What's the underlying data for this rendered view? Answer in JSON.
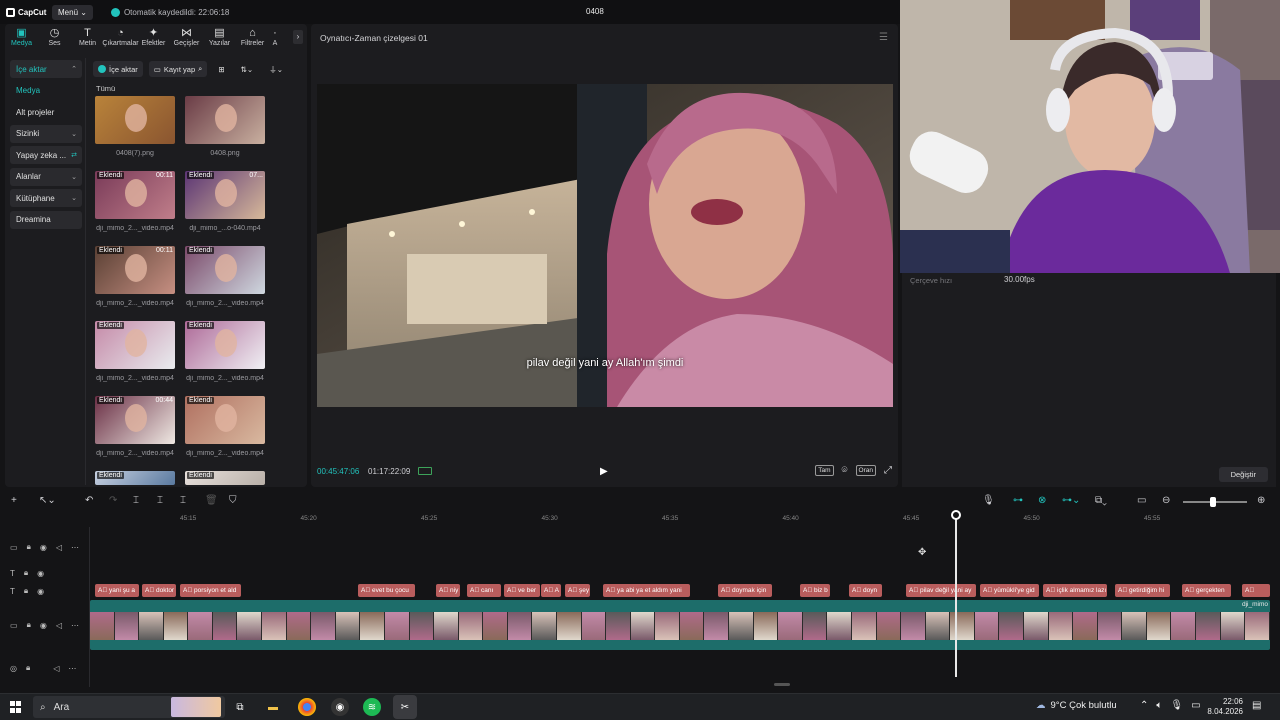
{
  "titlebar": {
    "app_name": "CapCut",
    "menu_label": "Menü",
    "autosave_text": "Otomatik kaydedildi: 22:06:18",
    "project_title": "0408"
  },
  "tabs": [
    {
      "label": "Medya",
      "icon": "media-icon"
    },
    {
      "label": "Ses",
      "icon": "audio-icon"
    },
    {
      "label": "Metin",
      "icon": "text-icon"
    },
    {
      "label": "Çıkartmalar",
      "icon": "sticker-icon"
    },
    {
      "label": "Efektler",
      "icon": "effects-icon"
    },
    {
      "label": "Geçişler",
      "icon": "transitions-icon"
    },
    {
      "label": "Yazılar",
      "icon": "captions-icon"
    },
    {
      "label": "Filtreler",
      "icon": "filters-icon"
    },
    {
      "label": "A",
      "icon": "adjust-icon"
    }
  ],
  "sidenav": [
    {
      "label": "İçe aktar",
      "chev": "⌃"
    },
    {
      "label": "Medya",
      "chev": ""
    },
    {
      "label": "Alt projeler",
      "chev": ""
    },
    {
      "label": "Sizinki",
      "chev": "⌄"
    },
    {
      "label": "Yapay zeka ...",
      "chev": "⇄"
    },
    {
      "label": "Alanlar",
      "chev": "⌄"
    },
    {
      "label": "Kütüphane",
      "chev": "⌄"
    },
    {
      "label": "Dreamina",
      "chev": ""
    }
  ],
  "media_toolbar": {
    "import_label": "İçe aktar",
    "record_label": "Kayıt yap"
  },
  "media": {
    "section_label": "Tümü",
    "items": [
      {
        "name": "0408(7).png",
        "badge": "",
        "duration": ""
      },
      {
        "name": "0408.png",
        "badge": "",
        "duration": ""
      },
      {
        "name": "dji_mimo_2..._video.mp4",
        "badge": "Eklendi",
        "duration": "00:11"
      },
      {
        "name": "dji_mimo_...o-040.mp4",
        "badge": "Eklendi",
        "duration": "07..."
      },
      {
        "name": "dji_mimo_2..._video.mp4",
        "badge": "Eklendi",
        "duration": "00:11"
      },
      {
        "name": "dji_mimo_2..._video.mp4",
        "badge": "Eklendi",
        "duration": ""
      },
      {
        "name": "dji_mimo_2..._video.mp4",
        "badge": "Eklendi",
        "duration": ""
      },
      {
        "name": "dji_mimo_2..._video.mp4",
        "badge": "Eklendi",
        "duration": ""
      },
      {
        "name": "dji_mimo_2..._video.mp4",
        "badge": "Eklendi",
        "duration": "00:44"
      },
      {
        "name": "dji_mimo_2..._video.mp4",
        "badge": "Eklendi",
        "duration": ""
      },
      {
        "name": "",
        "badge": "Eklendi",
        "duration": ""
      },
      {
        "name": "",
        "badge": "Eklendi",
        "duration": ""
      }
    ]
  },
  "player": {
    "title": "Oynatıcı-Zaman çizelgesi 01",
    "subtitle": "pilav değil yani ay Allah'ım şimdi",
    "current_time": "00:45:47:06",
    "total_time": "01:17:22:09",
    "controls": [
      "Tam",
      "Oran"
    ]
  },
  "details": {
    "fps_label": "Çerçeve hızı",
    "fps_value": "30.00fps",
    "change_label": "Değiştir"
  },
  "ruler_ticks": [
    "45:15",
    "45:20",
    "45:25",
    "45:30",
    "45:35",
    "45:40",
    "45:45",
    "45:50",
    "45:55"
  ],
  "subtitle_clips": [
    "yani şu a",
    "doktor",
    "porsiyon et ald",
    "evet bu çocu",
    "niy",
    "canı",
    "ve ber",
    "A",
    "şey",
    "ya abi ya et aldım yani",
    "doymak için",
    "biz b",
    "doyn",
    "pilav değil yani ay",
    "yümükli'ye gid",
    "içlik almamız lazı",
    "getirdiğim hi",
    "gerçekten",
    ""
  ],
  "video_track_label": "dji_mimo",
  "taskbar": {
    "search_placeholder": "Ara",
    "weather": "9°C  Çok bulutlu",
    "time": "22:06",
    "date": "8.04.2026"
  },
  "colors": {
    "accent": "#22c3bd",
    "subtitle_clip": "#b95d5d",
    "video_track": "#1d6d6a"
  }
}
